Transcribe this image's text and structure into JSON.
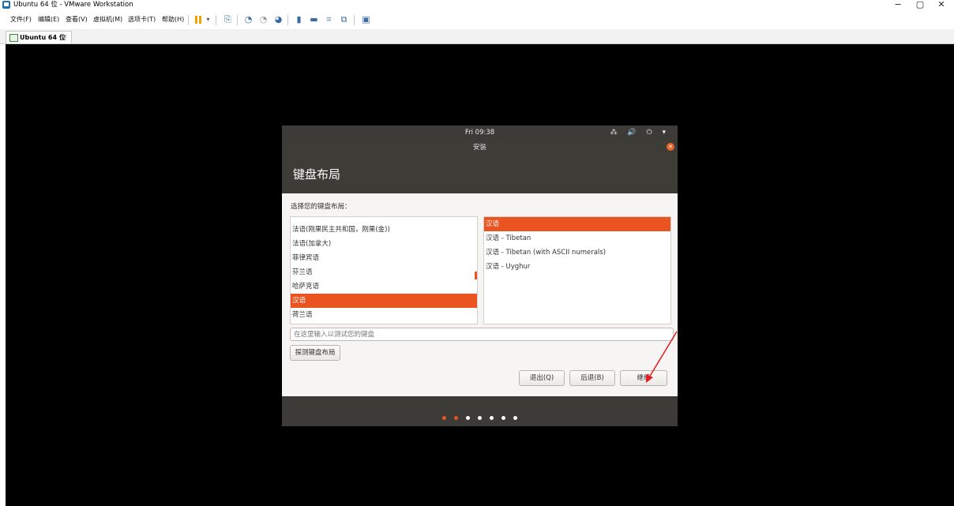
{
  "window": {
    "title": "Ubuntu 64 位 - VMware Workstation",
    "controls": {
      "minimize": "−",
      "maximize": "▢",
      "close": "✕"
    }
  },
  "menu": {
    "items": [
      "文件(F)",
      "编辑(E)",
      "查看(V)",
      "虚拟机(M)",
      "选项卡(T)",
      "帮助(H)"
    ]
  },
  "toolbar": {
    "icons": [
      "pause-icon",
      "dropdown-icon",
      "send-ctrl-alt-del-icon",
      "snapshot-icon",
      "revert-snapshot-icon",
      "snapshot-manager-icon",
      "console-view-icon",
      "thumbnail-bar-icon",
      "fit-window-icon",
      "fit-guest-icon",
      "unity-icon"
    ]
  },
  "tab": {
    "label": "Ubuntu 64 位",
    "close": "×"
  },
  "ubuntu_topbar": {
    "time": "Fri 09:38",
    "indicators": "⁂ 🔊 ⏻ ▾"
  },
  "installer": {
    "window_title": "安装",
    "heading": "键盘布局",
    "prompt": "选择您的键盘布局：",
    "layouts": [
      "法语(刚果民主共和国，刚果(金))",
      "法语(加拿大)",
      "菲律宾语",
      "芬兰语",
      "哈萨克语",
      "汉语",
      "荷兰语"
    ],
    "selected_layout": "汉语",
    "variants": [
      "汉语",
      "汉语 - Tibetan",
      "汉语 - Tibetan (with ASCII numerals)",
      "汉语 - Uyghur"
    ],
    "selected_variant": "汉语",
    "test_placeholder": "在这里输入以测试您的键盘",
    "detect_button": "探测键盘布局",
    "quit_button": "退出(Q)",
    "back_button": "后退(B)",
    "continue_button": "继续",
    "progress": {
      "total_steps": 7,
      "current_step": 2
    }
  },
  "colors": {
    "accent": "#e95420",
    "panel": "#3c3b37",
    "annotation": "#e8191f"
  }
}
